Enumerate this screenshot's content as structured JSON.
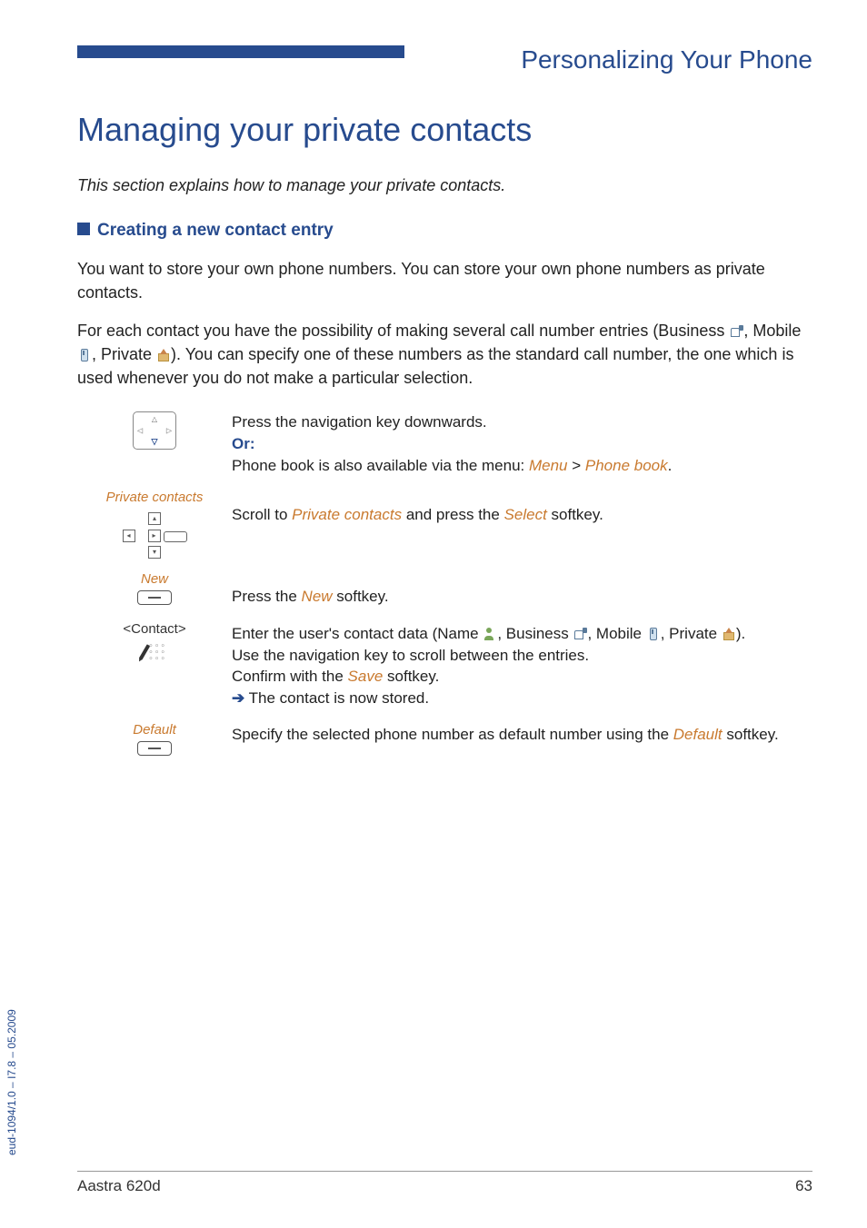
{
  "header": {
    "chapter_title": "Personalizing Your Phone"
  },
  "heading": "Managing your private contacts",
  "intro": "This section explains how to manage your private contacts.",
  "subheading": "Creating a new contact entry",
  "para1": "You want to store your own phone numbers. You can store your own phone numbers as private contacts.",
  "para2": {
    "pre": "For each contact you have the possibility of making several call number entries (Business ",
    "mid1": ", Mobile ",
    "mid2": ", Private ",
    "post": "). You can specify one of these numbers as the standard call number, the one which is used whenever you do not make a particular selection."
  },
  "steps": {
    "nav": {
      "line1": "Press the navigation key downwards.",
      "or": "Or:",
      "line2a": "Phone book is also available via the menu: ",
      "menu": "Menu",
      "gt": " > ",
      "phonebook": "Phone book",
      "dot": "."
    },
    "private": {
      "label": "Private contacts",
      "text_a": "Scroll to ",
      "orange": "Private contacts",
      "text_b": " and press the ",
      "select": "Select",
      "text_c": " softkey."
    },
    "new": {
      "label": "New",
      "text_a": "Press the ",
      "orange": "New",
      "text_b": " softkey."
    },
    "contact": {
      "label": "<Contact>",
      "line1a": "Enter the user's contact data (Name ",
      "line1b": ", Business ",
      "line1c": ", Mobile ",
      "line1d": ", Private ",
      "line1e": ").",
      "line2": "Use the navigation key to scroll between the entries.",
      "line3a": "Confirm with the ",
      "save": "Save",
      "line3b": " softkey.",
      "arrow": "➔",
      "line4": " The contact is now stored."
    },
    "default": {
      "label": "Default",
      "text_a": "Specify the selected phone number as default number using the ",
      "orange": "Default",
      "text_b": " softkey."
    }
  },
  "side": "eud-1094/1.0 – I7.8 – 05.2009",
  "footer": {
    "model": "Aastra 620d",
    "page": "63"
  }
}
